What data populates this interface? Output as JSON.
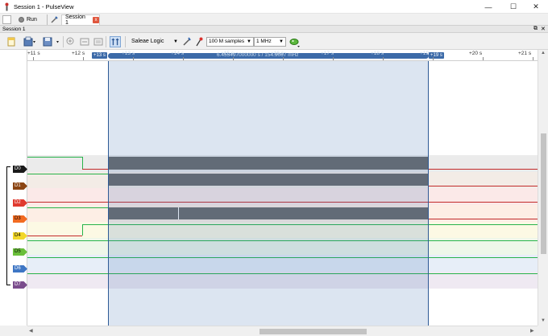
{
  "window": {
    "title": "Session 1 - PulseView",
    "minimize": "—",
    "maximize": "☐",
    "close": "✕"
  },
  "tabs": {
    "run_label": "Run",
    "session_tab_label": "Session 1",
    "session_tab_close": "x"
  },
  "session_header": {
    "label": "Session 1",
    "float_icon": "⧉",
    "close_icon": "✕"
  },
  "toolbar": {
    "device": "Saleae Logic",
    "samples": "100 M samples",
    "samplerate": "1 MHz",
    "icons": [
      "new-view-icon",
      "open-icon",
      "save-icon",
      "zoom-in-icon",
      "zoom-out-icon",
      "zoom-fit-icon",
      "cursor-icon",
      "probe-icon",
      "trigger-icon",
      "add-decoder-icon"
    ]
  },
  "ruler": {
    "ticks": [
      "+11 s",
      "+12 s",
      "+13 s",
      "+14 s",
      "+15 s",
      "+16 s",
      "+17 s",
      "+18 s",
      "+19 s",
      "+20 s",
      "+21 s"
    ],
    "cursor_left": "+13 s",
    "cursor_right": "+19 s",
    "cursor_info": "6.455497000000 s / 154.9067 mHz"
  },
  "channels": [
    {
      "name": "D0",
      "color": "#1a1a1a"
    },
    {
      "name": "D1",
      "color": "#8b4513"
    },
    {
      "name": "D2",
      "color": "#e03a2f"
    },
    {
      "name": "D3",
      "color": "#f26b22"
    },
    {
      "name": "D4",
      "color": "#f2d72a"
    },
    {
      "name": "D5",
      "color": "#6abf3a"
    },
    {
      "name": "D6",
      "color": "#3e76c4"
    },
    {
      "name": "D7",
      "color": "#7a4c8c"
    }
  ],
  "colors": {
    "accent": "#3c6aa8",
    "high_line": "#27b34a",
    "low_line": "#c22a2a"
  }
}
